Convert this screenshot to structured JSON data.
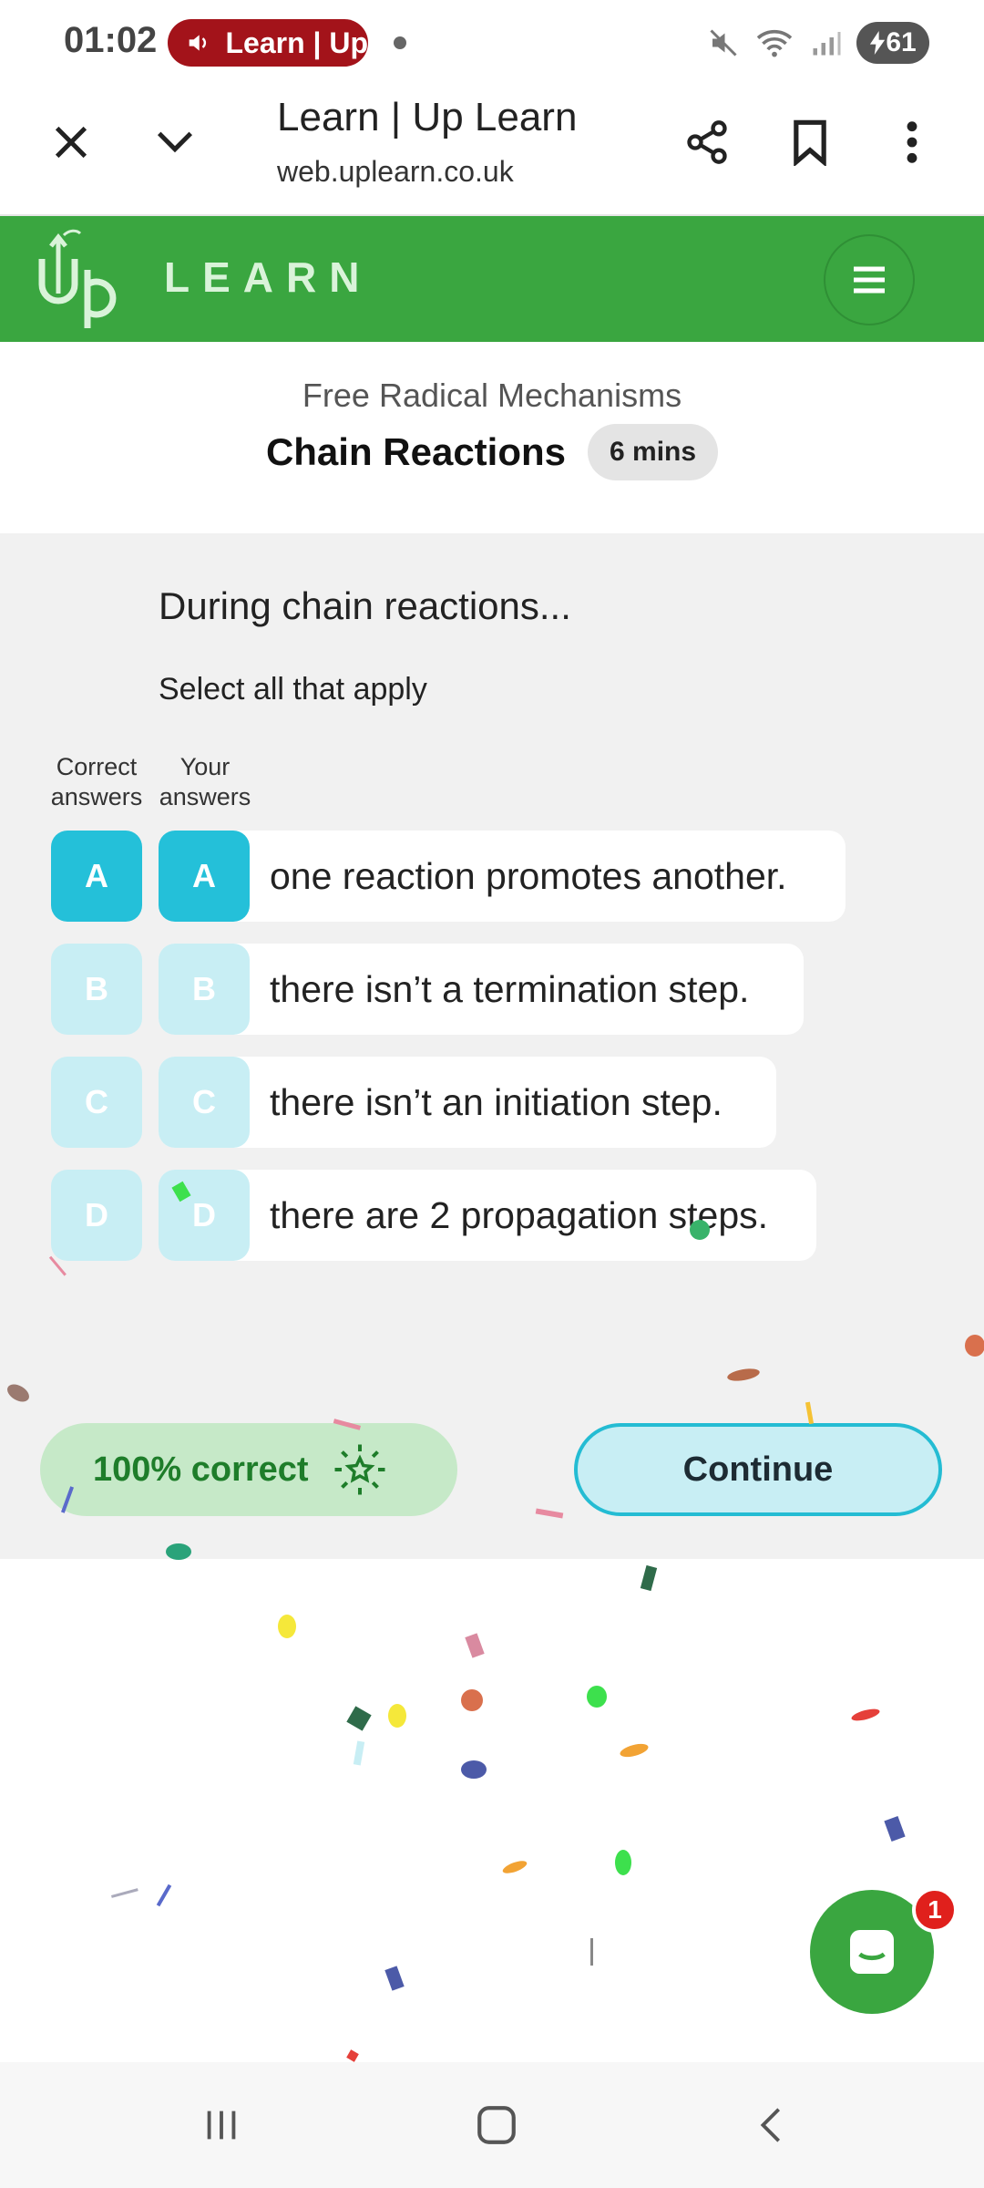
{
  "status_bar": {
    "time": "01:02",
    "media_label": "Learn | Up",
    "battery": "61"
  },
  "browser": {
    "title": "Learn | Up Learn",
    "url": "web.uplearn.co.uk"
  },
  "app_header": {
    "logo_text": "LEARN"
  },
  "lesson": {
    "topic": "Free Radical Mechanisms",
    "title": "Chain Reactions",
    "duration": "6 mins"
  },
  "question": {
    "prompt": "During chain reactions...",
    "hint": "Select all that apply",
    "col_correct": [
      "Correct",
      "answers"
    ],
    "col_yours": [
      "Your",
      "answers"
    ],
    "options": [
      {
        "letter": "A",
        "text": "one reaction promotes another.",
        "correct": true,
        "selected": true
      },
      {
        "letter": "B",
        "text": "there isn’t a termination step.",
        "correct": false,
        "selected": false
      },
      {
        "letter": "C",
        "text": "there isn’t an initiation step.",
        "correct": false,
        "selected": false
      },
      {
        "letter": "D",
        "text": "there are 2 propagation steps.",
        "correct": false,
        "selected": false
      }
    ]
  },
  "result": {
    "score_label": "100% correct",
    "continue_label": "Continue"
  },
  "chat": {
    "unread": "1"
  },
  "colors": {
    "brand_green": "#3aa640",
    "accent_cyan": "#24c0d9",
    "light_cyan": "#c8eef4"
  }
}
